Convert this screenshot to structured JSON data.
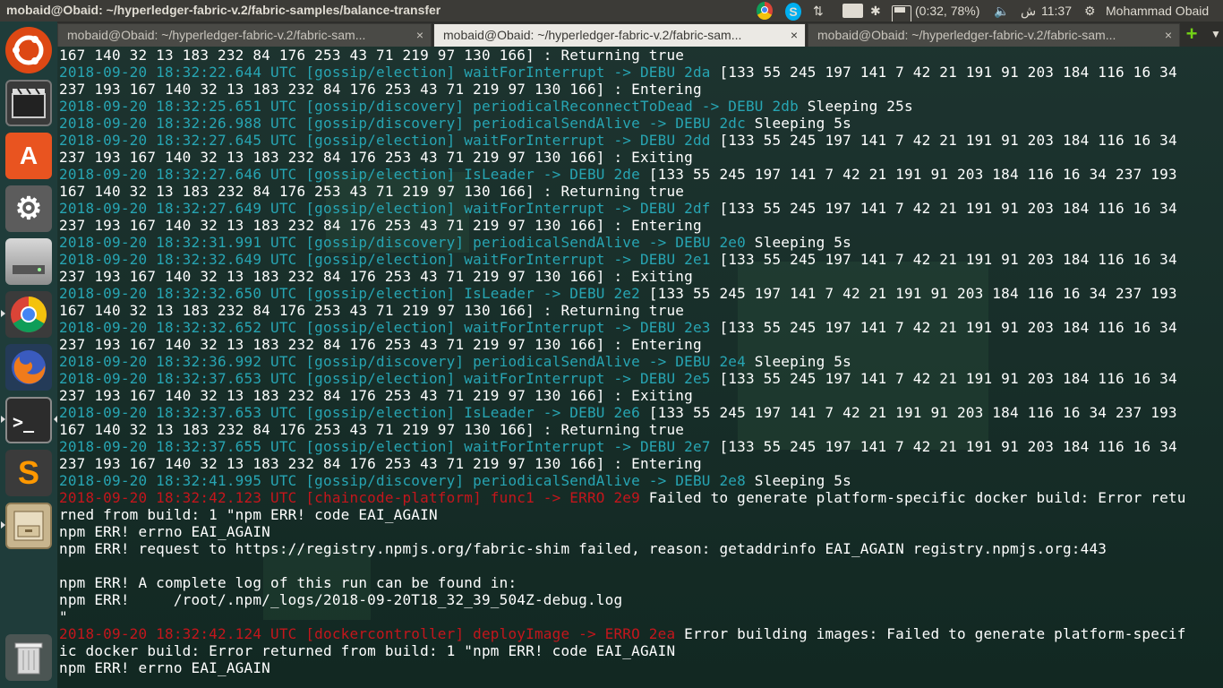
{
  "window_title": "mobaid@Obaid: ~/hyperledger-fabric-v.2/fabric-samples/balance-transfer",
  "indicators": {
    "battery_text": "(0:32, 78%)",
    "time": "11:37",
    "am_pm": "ش",
    "user": "Mohammad Obaid",
    "lang": "En"
  },
  "tabs": [
    {
      "label": "mobaid@Obaid: ~/hyperledger-fabric-v.2/fabric-sam...",
      "close": "×"
    },
    {
      "label": "mobaid@Obaid: ~/hyperledger-fabric-v.2/fabric-sam...",
      "close": "×"
    },
    {
      "label": "mobaid@Obaid: ~/hyperledger-fabric-v.2/fabric-sam...",
      "close": "×"
    }
  ],
  "launcher": [
    {
      "name": "ubuntu-dash-icon",
      "color": "#dd4814"
    },
    {
      "name": "video-editor-icon",
      "color": "#3a3a3a"
    },
    {
      "name": "software-center-icon",
      "color": "#e95420"
    },
    {
      "name": "system-settings-icon",
      "color": "#7a7a7a"
    },
    {
      "name": "disk-icon",
      "color": "#b0b0b0"
    },
    {
      "name": "chrome-icon",
      "color": "#4285f4"
    },
    {
      "name": "firefox-icon",
      "color": "#e66000"
    },
    {
      "name": "terminal-icon",
      "color": "#2c2c2c"
    },
    {
      "name": "sublime-text-icon",
      "color": "#ff9800"
    },
    {
      "name": "file-cabinet-icon",
      "color": "#c8b58e"
    },
    {
      "name": "trash-icon",
      "color": "#9a9a9a"
    }
  ],
  "terminal": {
    "lines": [
      {
        "a": "",
        "b": "",
        "c": "167 140 32 13 183 232 84 176 253 43 71 219 97 130 166] : Returning true"
      },
      {
        "a": "2018-09-20 18:32:22.644 UTC [gossip/election] waitForInterrupt -> DEBU 2da",
        "b": "",
        "c": " [133 55 245 197 141 7 42 21 191 91 203 184 116 16 34"
      },
      {
        "a": "",
        "b": "",
        "c": "237 193 167 140 32 13 183 232 84 176 253 43 71 219 97 130 166] : Entering"
      },
      {
        "a": "2018-09-20 18:32:25.651 UTC [gossip/discovery] periodicalReconnectToDead -> DEBU 2db",
        "b": "",
        "c": " Sleeping 25s"
      },
      {
        "a": "2018-09-20 18:32:26.988 UTC [gossip/discovery] periodicalSendAlive -> DEBU 2dc",
        "b": "",
        "c": " Sleeping 5s"
      },
      {
        "a": "2018-09-20 18:32:27.645 UTC [gossip/election] waitForInterrupt -> DEBU 2dd",
        "b": "",
        "c": " [133 55 245 197 141 7 42 21 191 91 203 184 116 16 34"
      },
      {
        "a": "",
        "b": "",
        "c": "237 193 167 140 32 13 183 232 84 176 253 43 71 219 97 130 166] : Exiting"
      },
      {
        "a": "2018-09-20 18:32:27.646 UTC [gossip/election] IsLeader -> DEBU 2de",
        "b": "",
        "c": " [133 55 245 197 141 7 42 21 191 91 203 184 116 16 34 237 193"
      },
      {
        "a": "",
        "b": "",
        "c": "167 140 32 13 183 232 84 176 253 43 71 219 97 130 166] : Returning true"
      },
      {
        "a": "2018-09-20 18:32:27.649 UTC [gossip/election] waitForInterrupt -> DEBU 2df",
        "b": "",
        "c": " [133 55 245 197 141 7 42 21 191 91 203 184 116 16 34"
      },
      {
        "a": "",
        "b": "",
        "c": "237 193 167 140 32 13 183 232 84 176 253 43 71 219 97 130 166] : Entering"
      },
      {
        "a": "2018-09-20 18:32:31.991 UTC [gossip/discovery] periodicalSendAlive -> DEBU 2e0",
        "b": "",
        "c": " Sleeping 5s"
      },
      {
        "a": "2018-09-20 18:32:32.649 UTC [gossip/election] waitForInterrupt -> DEBU 2e1",
        "b": "",
        "c": " [133 55 245 197 141 7 42 21 191 91 203 184 116 16 34"
      },
      {
        "a": "",
        "b": "",
        "c": "237 193 167 140 32 13 183 232 84 176 253 43 71 219 97 130 166] : Exiting"
      },
      {
        "a": "2018-09-20 18:32:32.650 UTC [gossip/election] IsLeader -> DEBU 2e2",
        "b": "",
        "c": " [133 55 245 197 141 7 42 21 191 91 203 184 116 16 34 237 193"
      },
      {
        "a": "",
        "b": "",
        "c": "167 140 32 13 183 232 84 176 253 43 71 219 97 130 166] : Returning true"
      },
      {
        "a": "2018-09-20 18:32:32.652 UTC [gossip/election] waitForInterrupt -> DEBU 2e3",
        "b": "",
        "c": " [133 55 245 197 141 7 42 21 191 91 203 184 116 16 34"
      },
      {
        "a": "",
        "b": "",
        "c": "237 193 167 140 32 13 183 232 84 176 253 43 71 219 97 130 166] : Entering"
      },
      {
        "a": "2018-09-20 18:32:36.992 UTC [gossip/discovery] periodicalSendAlive -> DEBU 2e4",
        "b": "",
        "c": " Sleeping 5s"
      },
      {
        "a": "2018-09-20 18:32:37.653 UTC [gossip/election] waitForInterrupt -> DEBU 2e5",
        "b": "",
        "c": " [133 55 245 197 141 7 42 21 191 91 203 184 116 16 34"
      },
      {
        "a": "",
        "b": "",
        "c": "237 193 167 140 32 13 183 232 84 176 253 43 71 219 97 130 166] : Exiting"
      },
      {
        "a": "2018-09-20 18:32:37.653 UTC [gossip/election] IsLeader -> DEBU 2e6",
        "b": "",
        "c": " [133 55 245 197 141 7 42 21 191 91 203 184 116 16 34 237 193"
      },
      {
        "a": "",
        "b": "",
        "c": "167 140 32 13 183 232 84 176 253 43 71 219 97 130 166] : Returning true"
      },
      {
        "a": "2018-09-20 18:32:37.655 UTC [gossip/election] waitForInterrupt -> DEBU 2e7",
        "b": "",
        "c": " [133 55 245 197 141 7 42 21 191 91 203 184 116 16 34"
      },
      {
        "a": "",
        "b": "",
        "c": "237 193 167 140 32 13 183 232 84 176 253 43 71 219 97 130 166] : Entering"
      },
      {
        "a": "2018-09-20 18:32:41.995 UTC [gossip/discovery] periodicalSendAlive -> DEBU 2e8",
        "b": "",
        "c": " Sleeping 5s"
      },
      {
        "a": "",
        "b": "2018-09-20 18:32:42.123 UTC [chaincode-platform] func1 -> ERRO 2e9",
        "c": " Failed to generate platform-specific docker build: Error retu"
      },
      {
        "a": "",
        "b": "",
        "c": "rned from build: 1 \"npm ERR! code EAI_AGAIN"
      },
      {
        "a": "",
        "b": "",
        "c": "npm ERR! errno EAI_AGAIN"
      },
      {
        "a": "",
        "b": "",
        "c": "npm ERR! request to https://registry.npmjs.org/fabric-shim failed, reason: getaddrinfo EAI_AGAIN registry.npmjs.org:443"
      },
      {
        "a": "",
        "b": "",
        "c": ""
      },
      {
        "a": "",
        "b": "",
        "c": "npm ERR! A complete log of this run can be found in:"
      },
      {
        "a": "",
        "b": "",
        "c": "npm ERR!     /root/.npm/_logs/2018-09-20T18_32_39_504Z-debug.log"
      },
      {
        "a": "",
        "b": "",
        "c": "\""
      },
      {
        "a": "",
        "b": "2018-09-20 18:32:42.124 UTC [dockercontroller] deployImage -> ERRO 2ea",
        "c": " Error building images: Failed to generate platform-specif"
      },
      {
        "a": "",
        "b": "",
        "c": "ic docker build: Error returned from build: 1 \"npm ERR! code EAI_AGAIN"
      },
      {
        "a": "",
        "b": "",
        "c": "npm ERR! errno EAI_AGAIN"
      }
    ]
  }
}
